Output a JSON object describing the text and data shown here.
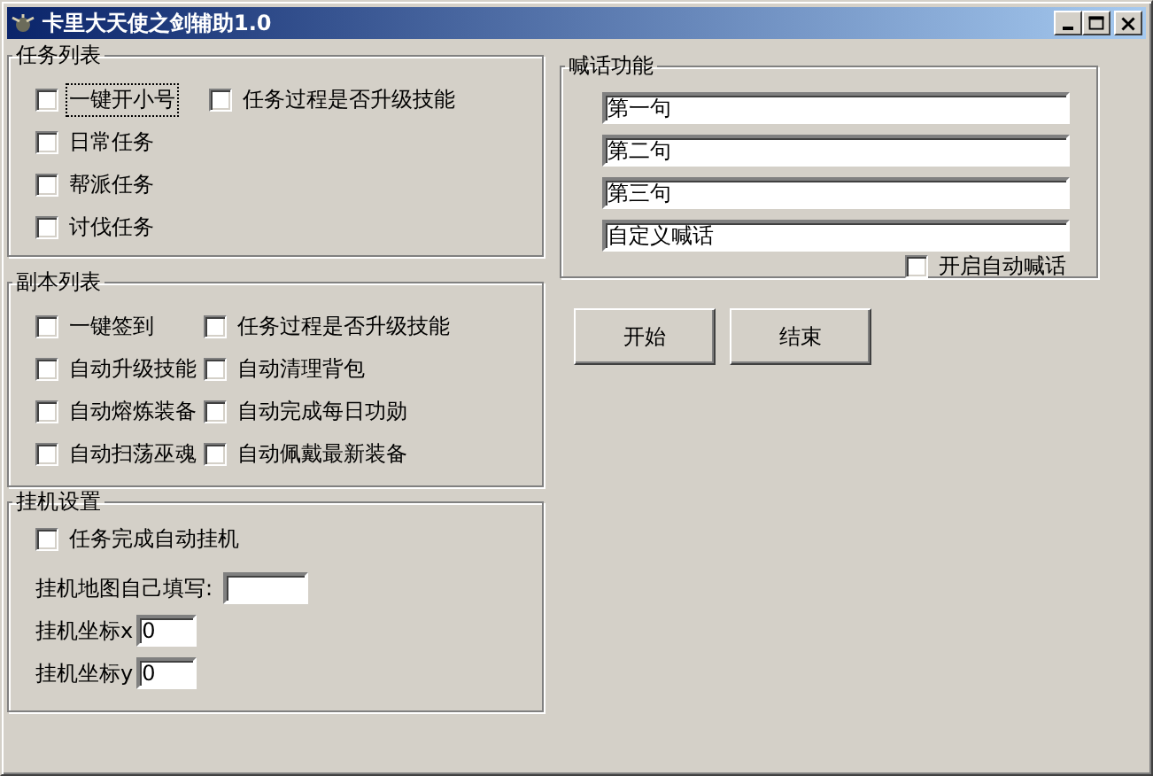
{
  "window": {
    "title": "卡里大天使之剑辅助1.0"
  },
  "task_list": {
    "title": "任务列表",
    "rows": [
      [
        {
          "label": "一键开小号",
          "checked": false,
          "focused": true
        },
        {
          "label": "任务过程是否升级技能",
          "checked": false,
          "focused": false
        }
      ],
      [
        {
          "label": "日常任务",
          "checked": false,
          "focused": false
        }
      ],
      [
        {
          "label": "帮派任务",
          "checked": false,
          "focused": false
        }
      ],
      [
        {
          "label": "讨伐任务",
          "checked": false,
          "focused": false
        }
      ]
    ]
  },
  "dungeon_list": {
    "title": "副本列表",
    "rows": [
      [
        {
          "label": "一键签到",
          "checked": false,
          "focused": false
        },
        {
          "label": "任务过程是否升级技能",
          "checked": false,
          "focused": false
        }
      ],
      [
        {
          "label": "自动升级技能",
          "checked": false,
          "focused": false
        },
        {
          "label": "自动清理背包",
          "checked": false,
          "focused": false
        }
      ],
      [
        {
          "label": "自动熔炼装备",
          "checked": false,
          "focused": false
        },
        {
          "label": "自动完成每日功勋",
          "checked": false,
          "focused": false
        }
      ],
      [
        {
          "label": "自动扫荡巫魂",
          "checked": false,
          "focused": false
        },
        {
          "label": "自动佩戴最新装备",
          "checked": false,
          "focused": false
        }
      ]
    ]
  },
  "idle_settings": {
    "title": "挂机设置",
    "option": {
      "label": "任务完成自动挂机",
      "checked": false,
      "focused": false
    },
    "fields": [
      {
        "label": "挂机地图自己填写:"
      },
      {
        "label": "挂机坐标x",
        "value": "0"
      },
      {
        "label": "挂机坐标y",
        "value": "0"
      }
    ]
  },
  "shout": {
    "title": "喊话功能",
    "fields": [
      {
        "value": "第一句"
      },
      {
        "value": "第二句"
      },
      {
        "value": "第三句"
      },
      {
        "value": "自定义喊话"
      }
    ],
    "option": {
      "label": "开启自动喊话",
      "checked": false,
      "focused": false
    }
  },
  "buttons": [
    "开始",
    "结束"
  ]
}
